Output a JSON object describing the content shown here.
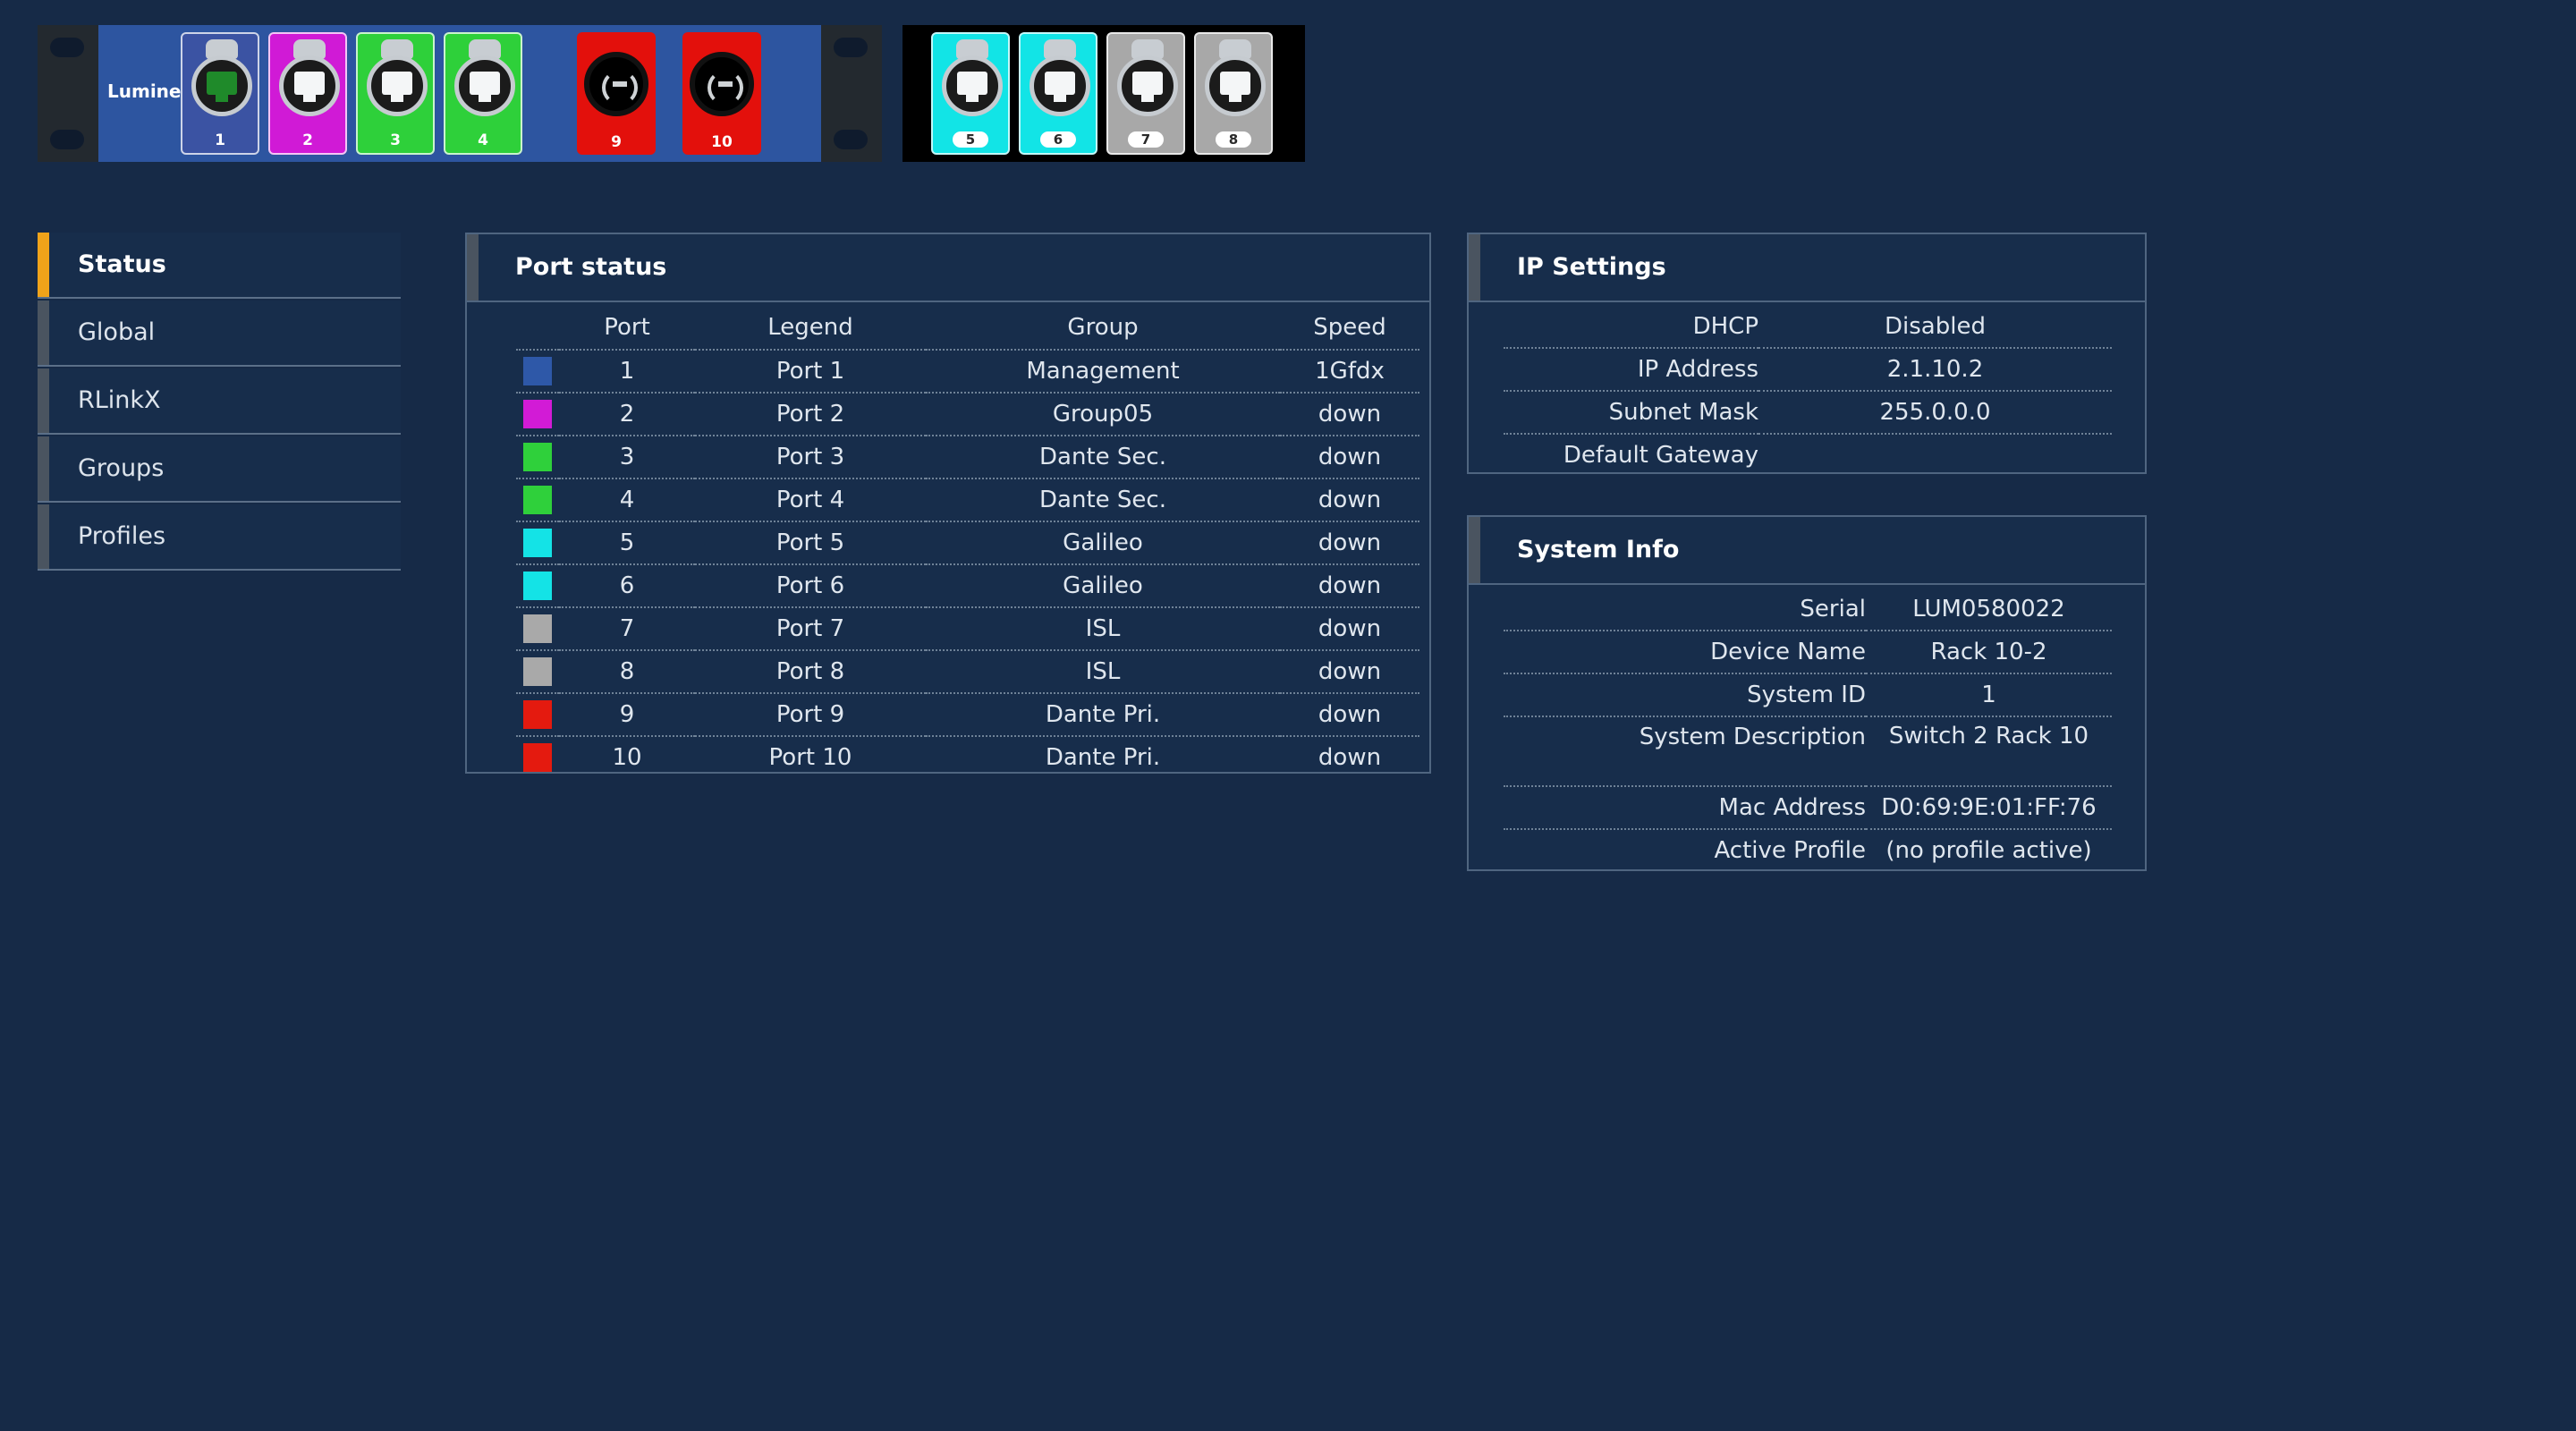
{
  "device": {
    "brand": "Luminex",
    "ports_unit1": [
      {
        "num": "1",
        "color": "#3b53a3",
        "type": "rj45",
        "active": true
      },
      {
        "num": "2",
        "color": "#d01ad6",
        "type": "rj45"
      },
      {
        "num": "3",
        "color": "#2ed03a",
        "type": "rj45"
      },
      {
        "num": "4",
        "color": "#2ed03a",
        "type": "rj45"
      },
      {
        "num": "9",
        "color": "#e3100c",
        "type": "xlr"
      },
      {
        "num": "10",
        "color": "#e3100c",
        "type": "xlr"
      }
    ],
    "ports_unit2": [
      {
        "num": "5",
        "color": "#12e4e6",
        "type": "rj45"
      },
      {
        "num": "6",
        "color": "#12e4e6",
        "type": "rj45"
      },
      {
        "num": "7",
        "color": "#a8a8a8",
        "type": "rj45"
      },
      {
        "num": "8",
        "color": "#a8a8a8",
        "type": "rj45"
      }
    ]
  },
  "sidebar": {
    "items": [
      {
        "label": "Status",
        "active": true
      },
      {
        "label": "Global"
      },
      {
        "label": "RLinkX"
      },
      {
        "label": "Groups"
      },
      {
        "label": "Profiles"
      }
    ]
  },
  "port_status": {
    "title": "Port status",
    "columns": [
      "Port",
      "Legend",
      "Group",
      "Speed"
    ],
    "rows": [
      {
        "color": "#2e58a8",
        "port": "1",
        "legend": "Port 1",
        "group": "Management",
        "speed": "1Gfdx"
      },
      {
        "color": "#d21bd6",
        "port": "2",
        "legend": "Port 2",
        "group": "Group05",
        "speed": "down"
      },
      {
        "color": "#2fd03b",
        "port": "3",
        "legend": "Port 3",
        "group": "Dante Sec.",
        "speed": "down"
      },
      {
        "color": "#2fd03b",
        "port": "4",
        "legend": "Port 4",
        "group": "Dante Sec.",
        "speed": "down"
      },
      {
        "color": "#14e3e6",
        "port": "5",
        "legend": "Port 5",
        "group": "Galileo",
        "speed": "down"
      },
      {
        "color": "#14e3e6",
        "port": "6",
        "legend": "Port 6",
        "group": "Galileo",
        "speed": "down"
      },
      {
        "color": "#a9a9a9",
        "port": "7",
        "legend": "Port 7",
        "group": "ISL",
        "speed": "down"
      },
      {
        "color": "#a9a9a9",
        "port": "8",
        "legend": "Port 8",
        "group": "ISL",
        "speed": "down"
      },
      {
        "color": "#e41a0f",
        "port": "9",
        "legend": "Port 9",
        "group": "Dante Pri.",
        "speed": "down"
      },
      {
        "color": "#e41a0f",
        "port": "10",
        "legend": "Port 10",
        "group": "Dante Pri.",
        "speed": "down"
      }
    ]
  },
  "ip_settings": {
    "title": "IP Settings",
    "rows": [
      {
        "key": "DHCP",
        "value": "Disabled"
      },
      {
        "key": "IP Address",
        "value": "2.1.10.2"
      },
      {
        "key": "Subnet Mask",
        "value": "255.0.0.0"
      },
      {
        "key": "Default Gateway",
        "value": ""
      }
    ]
  },
  "system_info": {
    "title": "System Info",
    "rows": [
      {
        "key": "Serial",
        "value": "LUM0580022"
      },
      {
        "key": "Device Name",
        "value": "Rack 10-2"
      },
      {
        "key": "System ID",
        "value": "1"
      },
      {
        "key": "System Description",
        "value": "Switch 2 Rack 10"
      },
      {
        "key": "Mac Address",
        "value": "D0:69:9E:01:FF:76"
      },
      {
        "key": "Active Profile",
        "value": "(no profile active)"
      }
    ]
  }
}
